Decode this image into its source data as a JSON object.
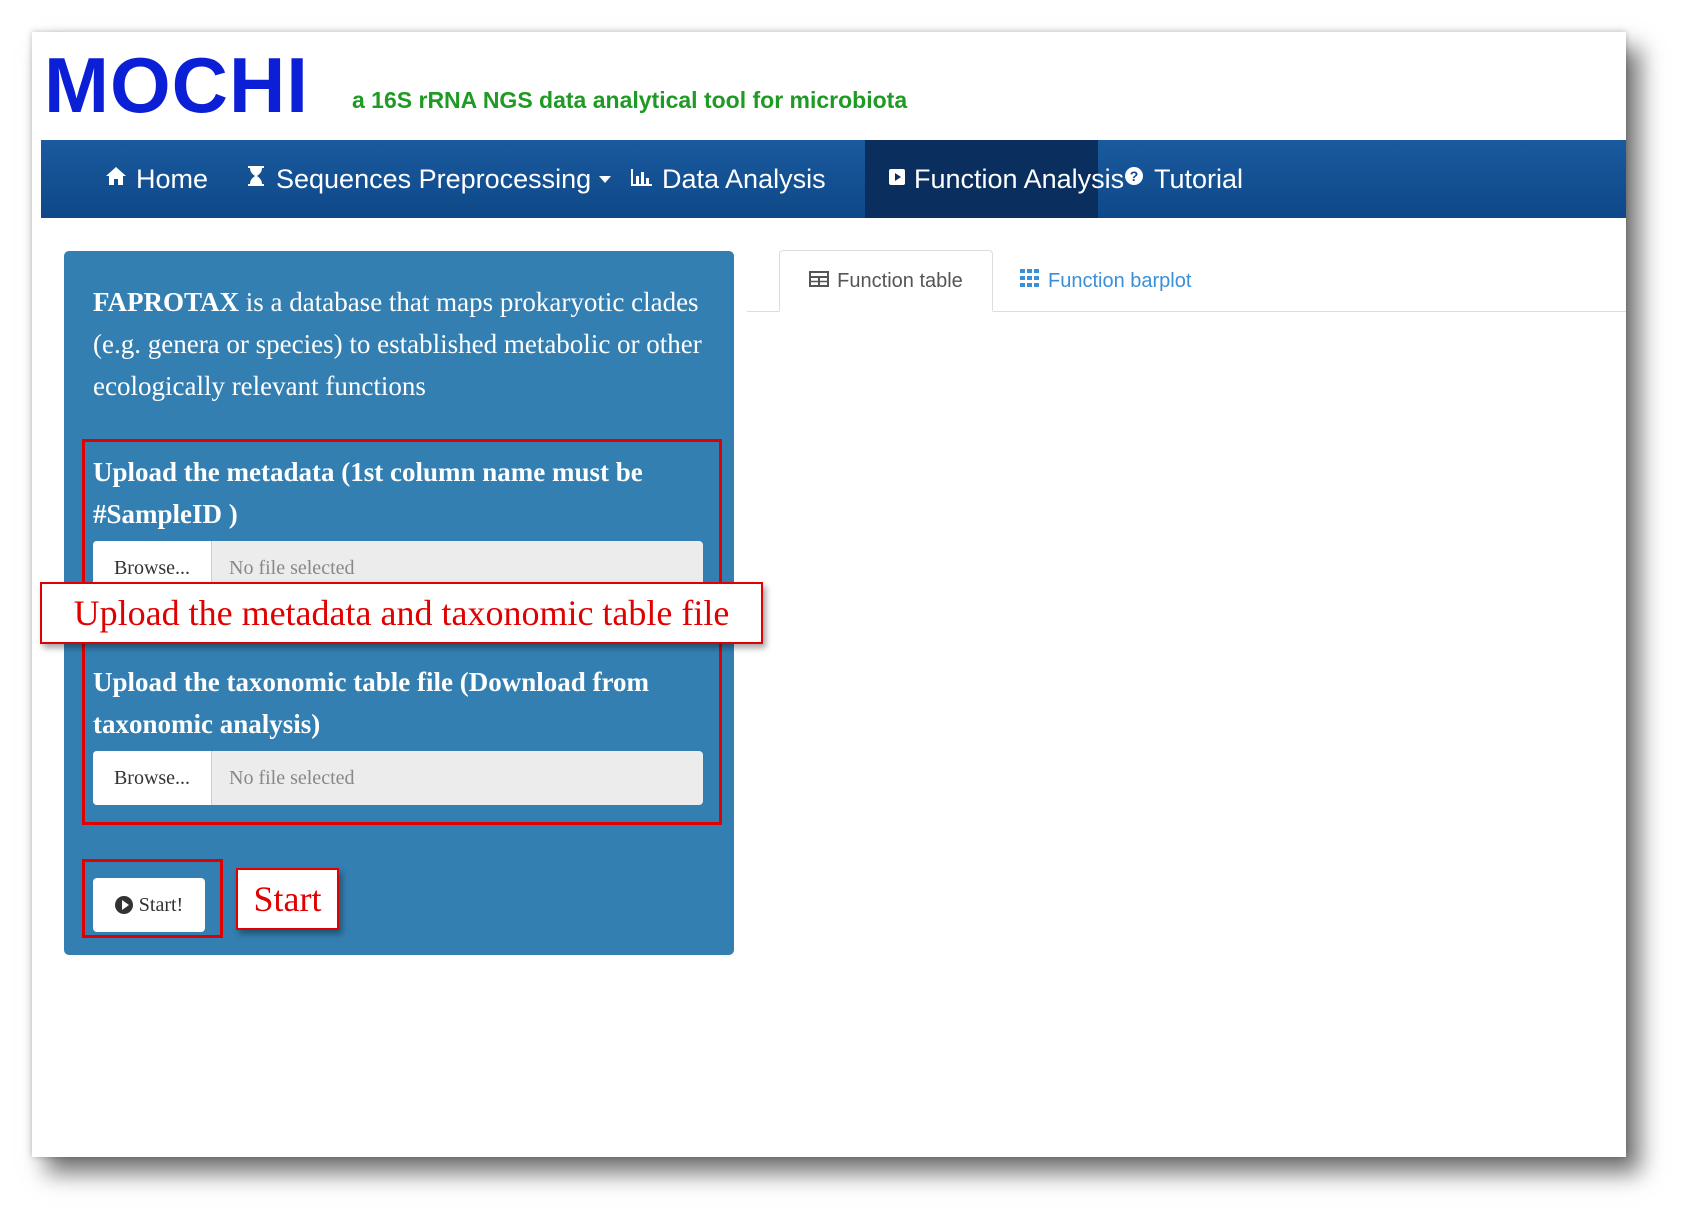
{
  "app": {
    "brand": "MOCHI",
    "tagline": "a 16S rRNA NGS data analytical tool for microbiota",
    "brand_color": "#0a1fd6",
    "tagline_color": "#1f9a24"
  },
  "navbar": {
    "items": [
      {
        "label": "Home",
        "icon": "home-icon"
      },
      {
        "label": "Sequences Preprocessing",
        "icon": "hourglass-icon",
        "dropdown": true
      },
      {
        "label": "Data Analysis",
        "icon": "bar-chart-icon"
      },
      {
        "label": "Function Analysis",
        "icon": "play-square-icon",
        "active": true
      },
      {
        "label": "Tutorial",
        "icon": "question-circle-icon"
      }
    ],
    "bg_color": "#0e4888",
    "active_color": "#0a2f5e"
  },
  "sidebar": {
    "intro_bold": "FAPROTAX",
    "intro_rest": " is a database that maps prokaryotic clades (e.g. genera or species) to established metabolic or other ecologically relevant functions",
    "metadata_label": "Upload the metadata (1st column name must be #SampleID )",
    "taxonomic_label": "Upload the taxonomic table file (Download from taxonomic analysis)",
    "browse_label": "Browse...",
    "no_file_text": "No file selected",
    "start_label": "Start!",
    "bg_color": "#337fb2"
  },
  "tabs": [
    {
      "label": "Function table",
      "icon": "table-icon",
      "active": true
    },
    {
      "label": "Function barplot",
      "icon": "grid-icon",
      "active": false
    }
  ],
  "annotations": {
    "upload_callout": "Upload the metadata and taxonomic table file",
    "start_callout": "Start",
    "color": "#e10000"
  }
}
